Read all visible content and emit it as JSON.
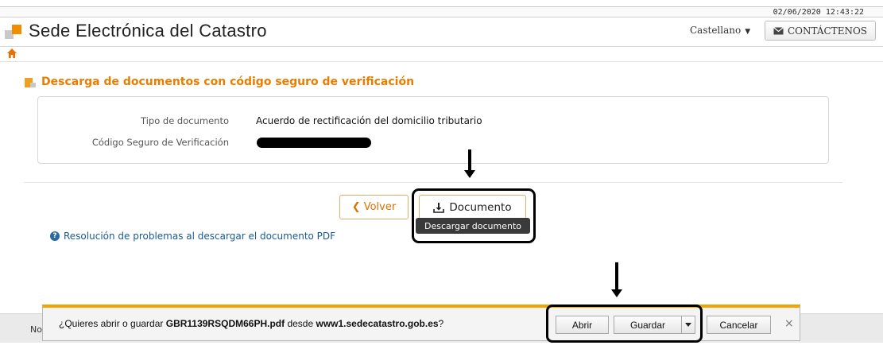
{
  "topbar": {
    "datetime": "02/06/2020 12:43:22"
  },
  "header": {
    "title": "Sede Electrónica del Catastro",
    "language": "Castellano",
    "contact_label": "CONTÁCTENOS"
  },
  "page": {
    "section_title": "Descarga de documentos con código seguro de verificación",
    "info": {
      "doc_type_label": "Tipo de documento",
      "doc_type_value": "Acuerdo de rectificación del domicilio tributario",
      "csv_label": "Código Seguro de Verificación"
    },
    "back_label": "Volver",
    "document_label": "Documento",
    "tooltip": "Descargar documento",
    "help_link": "Resolución de problemas al descargar el documento PDF"
  },
  "footer": {
    "text": "No"
  },
  "download_bar": {
    "prompt_prefix": "¿Quieres abrir o guardar ",
    "filename": "GBR1139RSQDM66PH.pdf",
    "prompt_mid": " desde ",
    "site": "www1.sedecatastro.gob.es",
    "prompt_suffix": "?",
    "open_label": "Abrir",
    "save_label": "Guardar",
    "cancel_label": "Cancelar",
    "close_symbol": "×"
  },
  "colors": {
    "accent": "#ea7d00",
    "link": "#1a5a90",
    "download_accent": "#f0a400"
  }
}
